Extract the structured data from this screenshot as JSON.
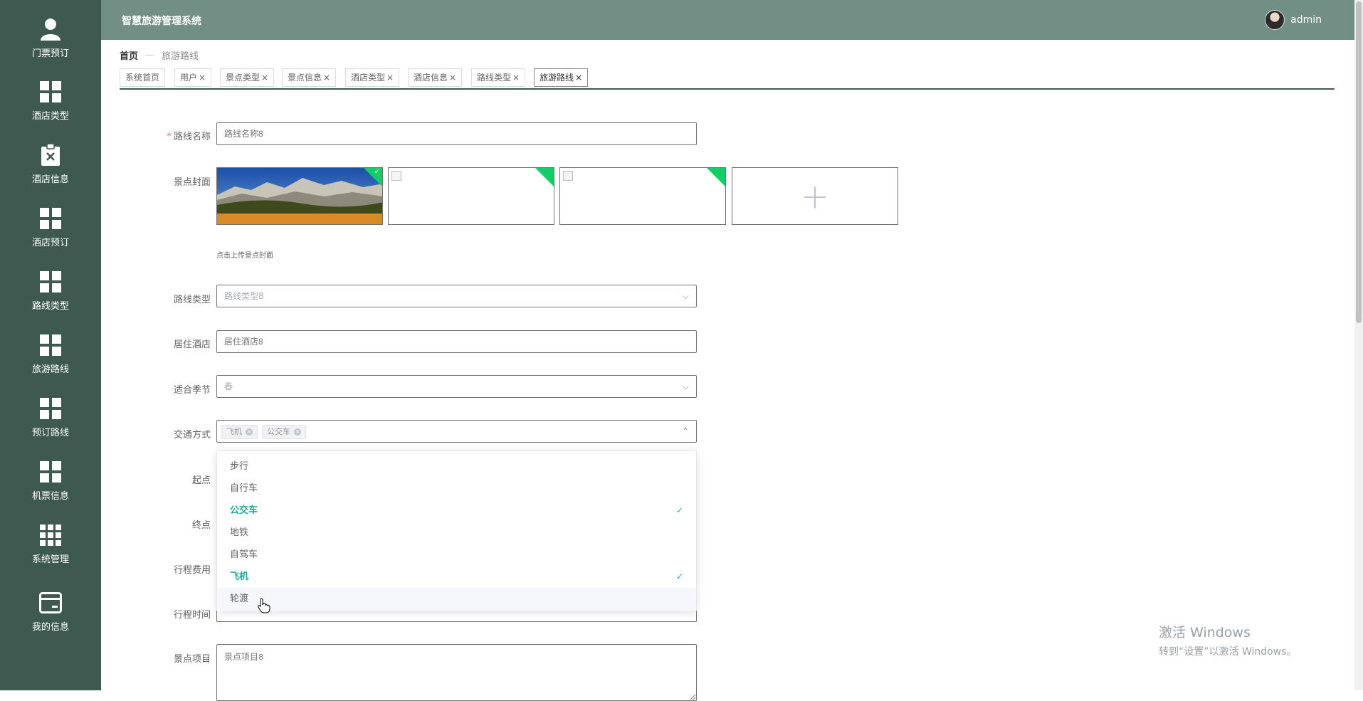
{
  "sidebar": {
    "items": [
      {
        "label": "门票预订",
        "icon": "user-icon"
      },
      {
        "label": "酒店类型",
        "icon": "grid-icon"
      },
      {
        "label": "酒店信息",
        "icon": "clipboard-x-icon"
      },
      {
        "label": "酒店预订",
        "icon": "grid-icon"
      },
      {
        "label": "路线类型",
        "icon": "grid-icon"
      },
      {
        "label": "旅游路线",
        "icon": "grid-icon"
      },
      {
        "label": "预订路线",
        "icon": "grid-icon"
      },
      {
        "label": "机票信息",
        "icon": "grid-icon"
      },
      {
        "label": "系统管理",
        "icon": "grid9-icon"
      },
      {
        "label": "我的信息",
        "icon": "card-icon"
      }
    ]
  },
  "header": {
    "title": "智慧旅游管理系统",
    "username": "admin"
  },
  "breadcrumb": {
    "home": "首页",
    "separator": "—",
    "current": "旅游路线"
  },
  "tabs": [
    {
      "label": "系统首页",
      "close": ""
    },
    {
      "label": "用户",
      "close": "×"
    },
    {
      "label": "景点类型",
      "close": "×"
    },
    {
      "label": "景点信息",
      "close": "×"
    },
    {
      "label": "酒店类型",
      "close": "×"
    },
    {
      "label": "酒店信息",
      "close": "×"
    },
    {
      "label": "路线类型",
      "close": "×"
    },
    {
      "label": "旅游路线",
      "close": "×"
    }
  ],
  "form": {
    "required_mark": "*",
    "route_name": {
      "label": "路线名称",
      "placeholder": "路线名称8"
    },
    "cover": {
      "label": "景点封面",
      "hint": "点击上传景点封面",
      "add": "+"
    },
    "route_type": {
      "label": "路线类型",
      "value": "路线类型8"
    },
    "hotel": {
      "label": "居住酒店",
      "placeholder": "居住酒店8"
    },
    "season": {
      "label": "适合季节",
      "value": "春"
    },
    "transport": {
      "label": "交通方式",
      "tags": [
        "飞机",
        "公交车"
      ],
      "tag_close": "×",
      "options": [
        {
          "label": "步行",
          "selected": false
        },
        {
          "label": "自行车",
          "selected": false
        },
        {
          "label": "公交车",
          "selected": true
        },
        {
          "label": "地铁",
          "selected": false
        },
        {
          "label": "自驾车",
          "selected": false
        },
        {
          "label": "飞机",
          "selected": true
        },
        {
          "label": "轮渡",
          "selected": false
        }
      ],
      "check": "✓"
    },
    "start": {
      "label": "起点"
    },
    "end": {
      "label": "终点"
    },
    "cost": {
      "label": "行程费用"
    },
    "time": {
      "label": "行程时间"
    },
    "project": {
      "label": "景点项目",
      "placeholder": "景点项目8"
    }
  },
  "watermark": {
    "line1": "激活 Windows",
    "line2": "转到“设置”以激活 Windows。"
  },
  "colors": {
    "sidebar": "#3e5a50",
    "header": "#718f84",
    "accent": "#1aa89a",
    "corner": "#13ce66"
  }
}
